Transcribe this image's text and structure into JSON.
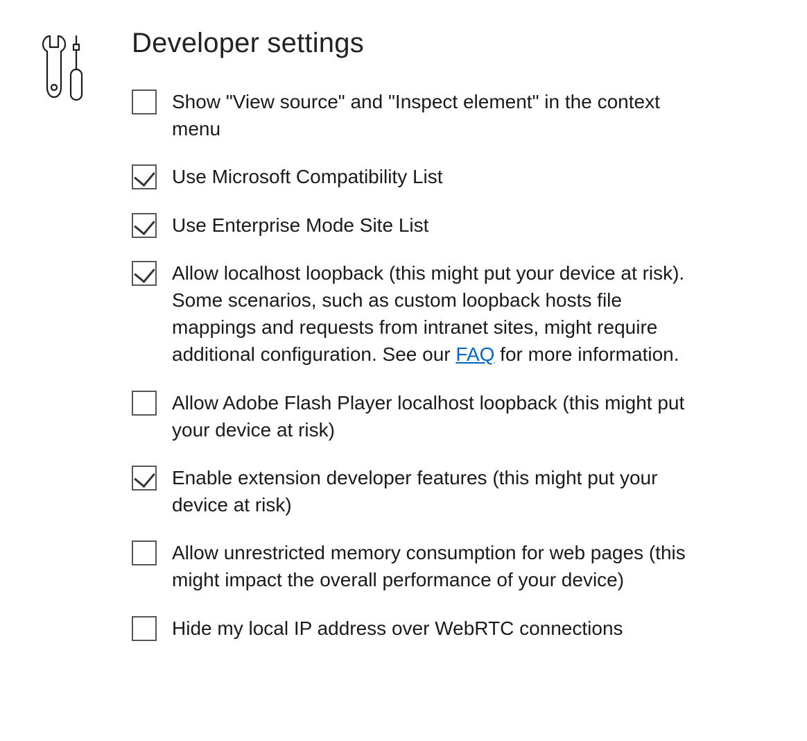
{
  "title": "Developer settings",
  "options": [
    {
      "name": "show-view-source",
      "checked": false,
      "label": "Show \"View source\" and \"Inspect element\" in the context menu"
    },
    {
      "name": "use-microsoft-compat-list",
      "checked": true,
      "label": "Use Microsoft Compatibility List"
    },
    {
      "name": "use-enterprise-mode-site-list",
      "checked": true,
      "label": "Use Enterprise Mode Site List"
    },
    {
      "name": "allow-localhost-loopback",
      "checked": true,
      "label_pre": "Allow localhost loopback (this might put your device at risk). Some scenarios, such as custom loopback hosts file mappings and requests from intranet sites, might require additional configuration. See our ",
      "link_text": "FAQ",
      "label_post": " for more information."
    },
    {
      "name": "allow-flash-loopback",
      "checked": false,
      "label": "Allow Adobe Flash Player localhost loopback (this might put your device at risk)"
    },
    {
      "name": "enable-extension-dev-features",
      "checked": true,
      "label": "Enable extension developer features (this might put your device at risk)"
    },
    {
      "name": "allow-unrestricted-memory",
      "checked": false,
      "label": "Allow unrestricted memory consumption for web pages (this might impact the overall performance of your device)"
    },
    {
      "name": "hide-local-ip-webrtc",
      "checked": false,
      "label": "Hide my local IP address over WebRTC connections"
    }
  ]
}
